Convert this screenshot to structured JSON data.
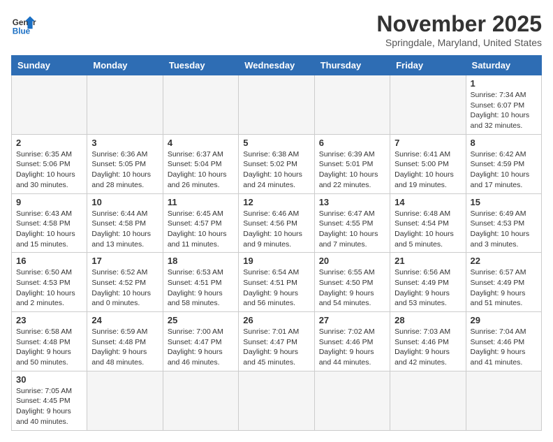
{
  "header": {
    "logo_line1": "General",
    "logo_line2": "Blue",
    "title": "November 2025",
    "subtitle": "Springdale, Maryland, United States"
  },
  "days_of_week": [
    "Sunday",
    "Monday",
    "Tuesday",
    "Wednesday",
    "Thursday",
    "Friday",
    "Saturday"
  ],
  "weeks": [
    [
      {
        "day": "",
        "info": ""
      },
      {
        "day": "",
        "info": ""
      },
      {
        "day": "",
        "info": ""
      },
      {
        "day": "",
        "info": ""
      },
      {
        "day": "",
        "info": ""
      },
      {
        "day": "",
        "info": ""
      },
      {
        "day": "1",
        "info": "Sunrise: 7:34 AM\nSunset: 6:07 PM\nDaylight: 10 hours and 32 minutes."
      }
    ],
    [
      {
        "day": "2",
        "info": "Sunrise: 6:35 AM\nSunset: 5:06 PM\nDaylight: 10 hours and 30 minutes."
      },
      {
        "day": "3",
        "info": "Sunrise: 6:36 AM\nSunset: 5:05 PM\nDaylight: 10 hours and 28 minutes."
      },
      {
        "day": "4",
        "info": "Sunrise: 6:37 AM\nSunset: 5:04 PM\nDaylight: 10 hours and 26 minutes."
      },
      {
        "day": "5",
        "info": "Sunrise: 6:38 AM\nSunset: 5:02 PM\nDaylight: 10 hours and 24 minutes."
      },
      {
        "day": "6",
        "info": "Sunrise: 6:39 AM\nSunset: 5:01 PM\nDaylight: 10 hours and 22 minutes."
      },
      {
        "day": "7",
        "info": "Sunrise: 6:41 AM\nSunset: 5:00 PM\nDaylight: 10 hours and 19 minutes."
      },
      {
        "day": "8",
        "info": "Sunrise: 6:42 AM\nSunset: 4:59 PM\nDaylight: 10 hours and 17 minutes."
      }
    ],
    [
      {
        "day": "9",
        "info": "Sunrise: 6:43 AM\nSunset: 4:58 PM\nDaylight: 10 hours and 15 minutes."
      },
      {
        "day": "10",
        "info": "Sunrise: 6:44 AM\nSunset: 4:58 PM\nDaylight: 10 hours and 13 minutes."
      },
      {
        "day": "11",
        "info": "Sunrise: 6:45 AM\nSunset: 4:57 PM\nDaylight: 10 hours and 11 minutes."
      },
      {
        "day": "12",
        "info": "Sunrise: 6:46 AM\nSunset: 4:56 PM\nDaylight: 10 hours and 9 minutes."
      },
      {
        "day": "13",
        "info": "Sunrise: 6:47 AM\nSunset: 4:55 PM\nDaylight: 10 hours and 7 minutes."
      },
      {
        "day": "14",
        "info": "Sunrise: 6:48 AM\nSunset: 4:54 PM\nDaylight: 10 hours and 5 minutes."
      },
      {
        "day": "15",
        "info": "Sunrise: 6:49 AM\nSunset: 4:53 PM\nDaylight: 10 hours and 3 minutes."
      }
    ],
    [
      {
        "day": "16",
        "info": "Sunrise: 6:50 AM\nSunset: 4:53 PM\nDaylight: 10 hours and 2 minutes."
      },
      {
        "day": "17",
        "info": "Sunrise: 6:52 AM\nSunset: 4:52 PM\nDaylight: 10 hours and 0 minutes."
      },
      {
        "day": "18",
        "info": "Sunrise: 6:53 AM\nSunset: 4:51 PM\nDaylight: 9 hours and 58 minutes."
      },
      {
        "day": "19",
        "info": "Sunrise: 6:54 AM\nSunset: 4:51 PM\nDaylight: 9 hours and 56 minutes."
      },
      {
        "day": "20",
        "info": "Sunrise: 6:55 AM\nSunset: 4:50 PM\nDaylight: 9 hours and 54 minutes."
      },
      {
        "day": "21",
        "info": "Sunrise: 6:56 AM\nSunset: 4:49 PM\nDaylight: 9 hours and 53 minutes."
      },
      {
        "day": "22",
        "info": "Sunrise: 6:57 AM\nSunset: 4:49 PM\nDaylight: 9 hours and 51 minutes."
      }
    ],
    [
      {
        "day": "23",
        "info": "Sunrise: 6:58 AM\nSunset: 4:48 PM\nDaylight: 9 hours and 50 minutes."
      },
      {
        "day": "24",
        "info": "Sunrise: 6:59 AM\nSunset: 4:48 PM\nDaylight: 9 hours and 48 minutes."
      },
      {
        "day": "25",
        "info": "Sunrise: 7:00 AM\nSunset: 4:47 PM\nDaylight: 9 hours and 46 minutes."
      },
      {
        "day": "26",
        "info": "Sunrise: 7:01 AM\nSunset: 4:47 PM\nDaylight: 9 hours and 45 minutes."
      },
      {
        "day": "27",
        "info": "Sunrise: 7:02 AM\nSunset: 4:46 PM\nDaylight: 9 hours and 44 minutes."
      },
      {
        "day": "28",
        "info": "Sunrise: 7:03 AM\nSunset: 4:46 PM\nDaylight: 9 hours and 42 minutes."
      },
      {
        "day": "29",
        "info": "Sunrise: 7:04 AM\nSunset: 4:46 PM\nDaylight: 9 hours and 41 minutes."
      }
    ],
    [
      {
        "day": "30",
        "info": "Sunrise: 7:05 AM\nSunset: 4:45 PM\nDaylight: 9 hours and 40 minutes."
      },
      {
        "day": "",
        "info": ""
      },
      {
        "day": "",
        "info": ""
      },
      {
        "day": "",
        "info": ""
      },
      {
        "day": "",
        "info": ""
      },
      {
        "day": "",
        "info": ""
      },
      {
        "day": "",
        "info": ""
      }
    ]
  ]
}
